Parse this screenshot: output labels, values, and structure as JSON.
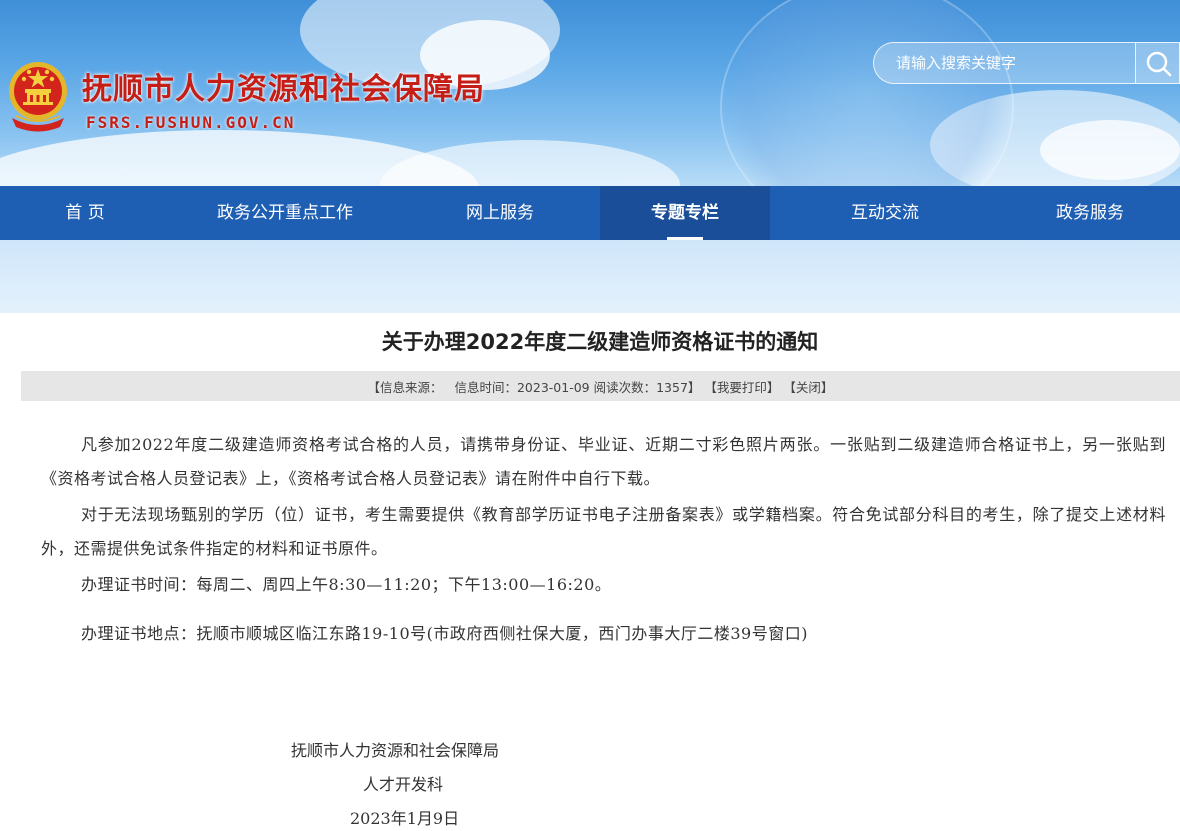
{
  "header": {
    "site_title": "抚顺市人力资源和社会保障局",
    "site_domain": "FSRS.FUSHUN.GOV.CN",
    "emblem_icon": "national-emblem-icon",
    "search": {
      "placeholder": "请输入搜索关键字",
      "button_icon": "search-icon"
    }
  },
  "nav": {
    "items": [
      {
        "label": "首 页"
      },
      {
        "label": "政务公开重点工作"
      },
      {
        "label": "网上服务"
      },
      {
        "label": "专题专栏"
      },
      {
        "label": "互动交流"
      },
      {
        "label": "政务服务"
      }
    ],
    "active_index": 3
  },
  "article": {
    "title": "关于办理2022年度二级建造师资格证书的通知",
    "meta": {
      "source": "【信息来源：   信息时间：2023-01-09 阅读次数：1357】",
      "print": "【我要打印】",
      "close": "【关闭】"
    },
    "paragraphs": [
      "凡参加2022年度二级建造师资格考试合格的人员，请携带身份证、毕业证、近期二寸彩色照片两张。一张贴到二级建造师合格证书上，另一张贴到《资格考试合格人员登记表》上，《资格考试合格人员登记表》请在附件中自行下载。",
      "对于无法现场甄别的学历（位）证书，考生需要提供《教育部学历证书电子注册备案表》或学籍档案。符合免试部分科目的考生，除了提交上述材料外，还需提供免试条件指定的材料和证书原件。",
      "办理证书时间：每周二、周四上午8:30—11:20；下午13:00—16:20。",
      "办理证书地点：抚顺市顺城区临江东路19-10号(市政府西侧社保大厦，西门办事大厅二楼39号窗口)"
    ],
    "signature": {
      "org": "抚顺市人力资源和社会保障局",
      "dept": "人才开发科",
      "date": "2023年1月9日"
    }
  },
  "colors": {
    "title_red": "#c51e16",
    "nav_blue": "#1f5fb3",
    "nav_active": "#1a4e99",
    "meta_bar": "#e6e6e6"
  }
}
